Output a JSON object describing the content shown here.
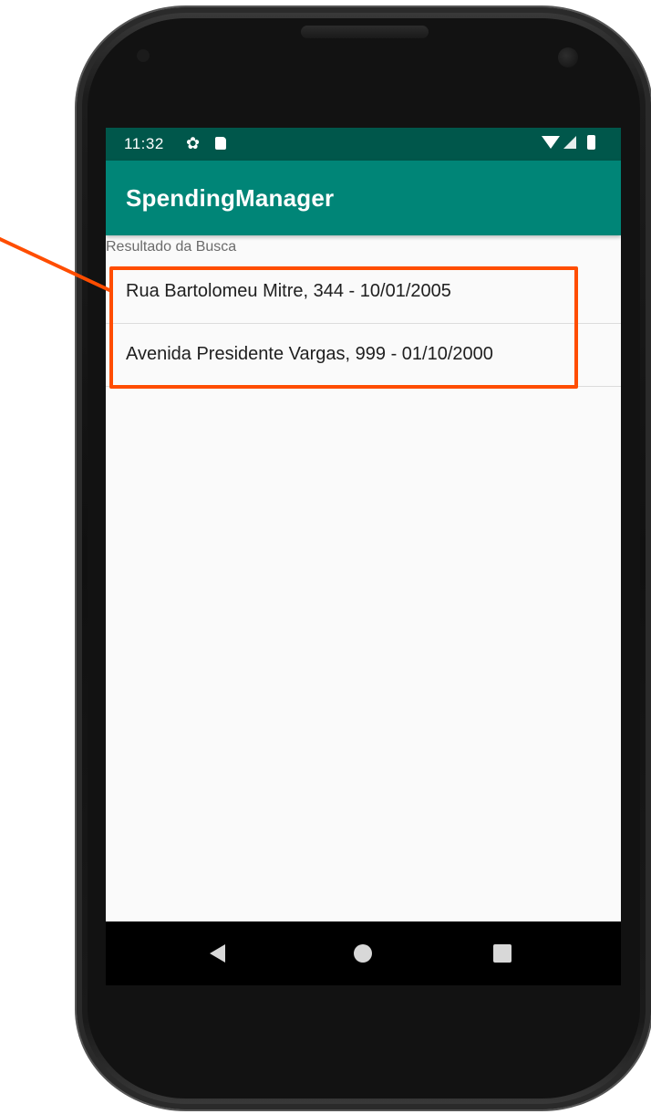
{
  "status_bar": {
    "time": "11:32",
    "icons": [
      "gear-icon",
      "sd-card-icon",
      "wifi-icon",
      "signal-icon",
      "battery-icon"
    ],
    "background": "#00574b"
  },
  "app_bar": {
    "title": "SpendingManager",
    "background": "#008577"
  },
  "content": {
    "section_label": "Resultado da Busca",
    "items": [
      {
        "label": "Rua Bartolomeu Mitre, 344 - 10/01/2005"
      },
      {
        "label": "Avenida Presidente Vargas, 999 - 01/10/2000"
      }
    ]
  },
  "nav_bar": {
    "icons": [
      "back-icon",
      "home-icon",
      "recents-icon"
    ]
  },
  "annotation": {
    "color": "#ff4d00"
  }
}
